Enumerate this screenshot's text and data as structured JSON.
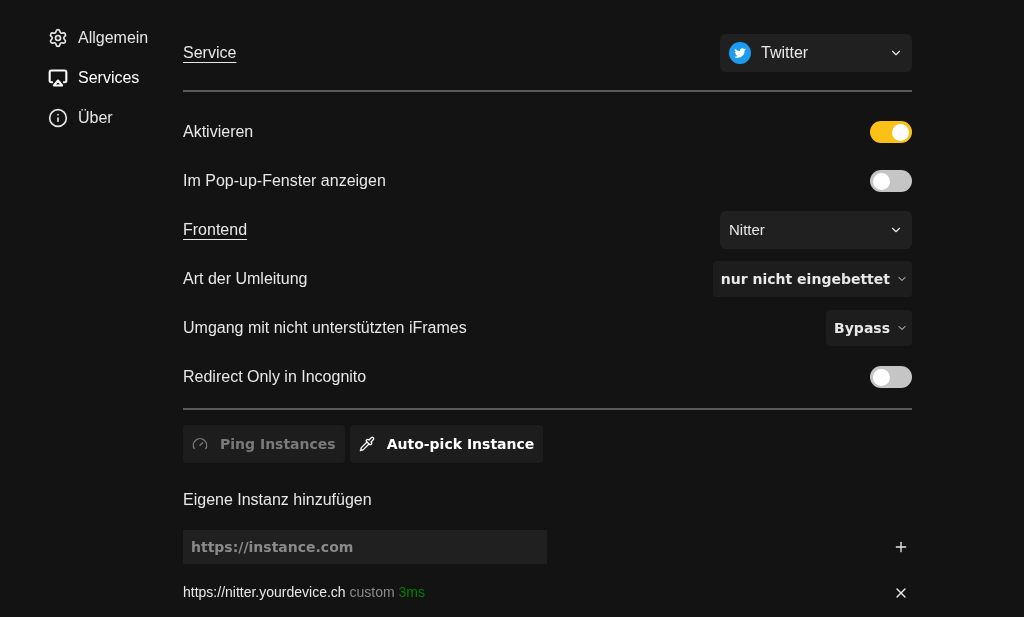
{
  "sidebar": {
    "items": [
      {
        "label": "Allgemein",
        "kind": "gear",
        "selected": false
      },
      {
        "label": "Services",
        "kind": "screen",
        "selected": true
      },
      {
        "label": "Über",
        "kind": "info",
        "selected": false
      }
    ]
  },
  "service": {
    "label": "Service",
    "value": "Twitter"
  },
  "settings": [
    {
      "kind": "toggle",
      "label": "Aktivieren",
      "link": false,
      "on": true
    },
    {
      "kind": "toggle",
      "label": "Im Pop-up-Fenster anzeigen",
      "link": false,
      "on": false
    },
    {
      "kind": "select",
      "label": "Frontend",
      "link": true,
      "value": "Nitter"
    },
    {
      "kind": "compact-select",
      "label": "Art der Umleitung",
      "link": false,
      "value": "nur nicht eingebettet"
    },
    {
      "kind": "compact-select",
      "label": "Umgang mit nicht unterstützten iFrames",
      "link": false,
      "value": "Bypass"
    },
    {
      "kind": "toggle",
      "label": "Redirect Only in Incognito",
      "link": false,
      "on": false
    }
  ],
  "actions": [
    {
      "label": "Ping Instances",
      "kind": "gauge",
      "disabled": true
    },
    {
      "label": "Auto-pick Instance",
      "kind": "pipette",
      "disabled": false
    }
  ],
  "custom_instance": {
    "label": "Eigene Instanz hinzufügen",
    "placeholder": "https://instance.com"
  },
  "instances": [
    {
      "url": "https://nitter.yourdevice.ch",
      "type": "custom",
      "latency": "3ms",
      "color": "#008000"
    }
  ]
}
